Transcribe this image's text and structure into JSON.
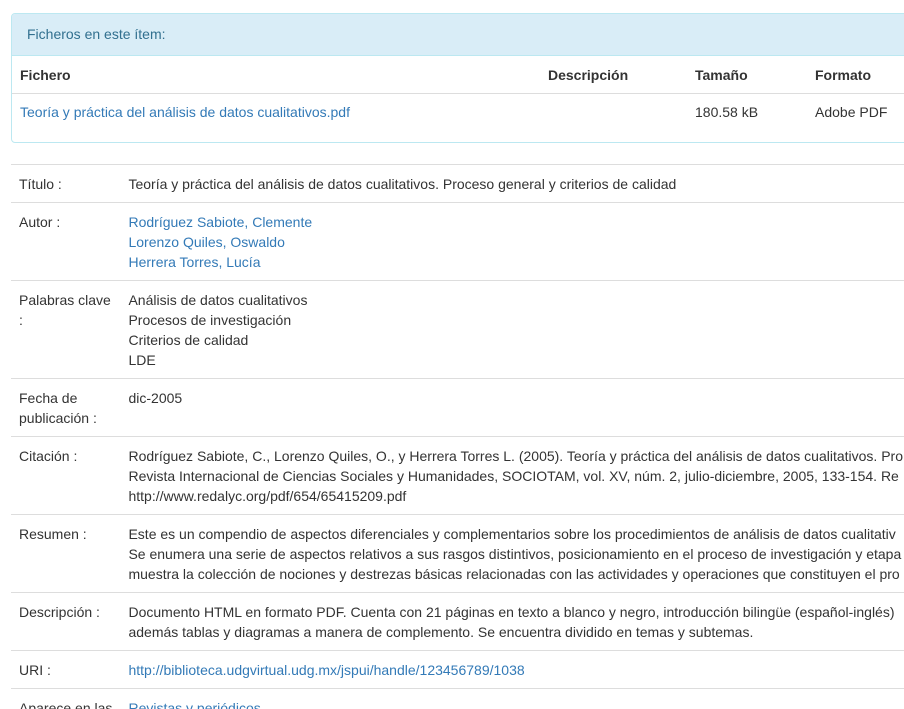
{
  "files": {
    "heading": "Ficheros en este ítem:",
    "columns": {
      "file": "Fichero",
      "description": "Descripción",
      "size": "Tamaño",
      "format": "Formato"
    },
    "rows": [
      {
        "file": "Teoría y práctica del análisis de datos cualitativos.pdf",
        "description": "",
        "size": "180.58 kB",
        "format": "Adobe PDF"
      }
    ]
  },
  "metadata": {
    "title": {
      "label": "Título :",
      "value": "Teoría y práctica del análisis de datos cualitativos. Proceso general y criterios de calidad"
    },
    "author": {
      "label": "Autor :",
      "values": [
        "Rodríguez Sabiote, Clemente",
        "Lorenzo Quiles, Oswaldo",
        "Herrera Torres, Lucía"
      ]
    },
    "keywords": {
      "label": "Palabras clave :",
      "values": [
        "Análisis de datos cualitativos",
        "Procesos de investigación",
        "Criterios de calidad",
        "LDE"
      ]
    },
    "date": {
      "label": "Fecha de publicación :",
      "value": "dic-2005"
    },
    "citation": {
      "label": "Citación :",
      "lines": [
        "Rodríguez Sabiote, C., Lorenzo Quiles, O., y Herrera Torres L. (2005). Teoría y práctica del análisis de datos cualitativos. Pro",
        "Revista Internacional de Ciencias Sociales y Humanidades, SOCIOTAM, vol. XV, núm. 2, julio-diciembre, 2005, 133-154. Re",
        "http://www.redalyc.org/pdf/654/65415209.pdf"
      ]
    },
    "abstract": {
      "label": "Resumen :",
      "lines": [
        "Este es un compendio de aspectos diferenciales y complementarios sobre los procedimientos de análisis de datos cualitativ",
        "Se enumera una serie de aspectos relativos a sus rasgos distintivos, posicionamiento en el proceso de investigación y etapa",
        "muestra la colección de nociones y destrezas básicas relacionadas con las actividades y operaciones que constituyen el pro"
      ]
    },
    "description": {
      "label": "Descripción :",
      "lines": [
        "Documento HTML en formato PDF. Cuenta con 21 páginas en texto a blanco y negro, introducción bilingüe (español-inglés)",
        "además tablas y diagramas a manera de complemento. Se encuentra dividido en temas y subtemas."
      ]
    },
    "uri": {
      "label": "URI :",
      "value": "http://biblioteca.udgvirtual.udg.mx/jspui/handle/123456789/1038"
    },
    "collections": {
      "label": "Aparece en las",
      "value": "Revistas y periódicos"
    }
  },
  "colors": {
    "link": "#337ab7",
    "panel_heading_bg": "#d9edf7",
    "panel_heading_text": "#31708f",
    "panel_border": "#bce8f1",
    "divider": "#dddddd"
  }
}
